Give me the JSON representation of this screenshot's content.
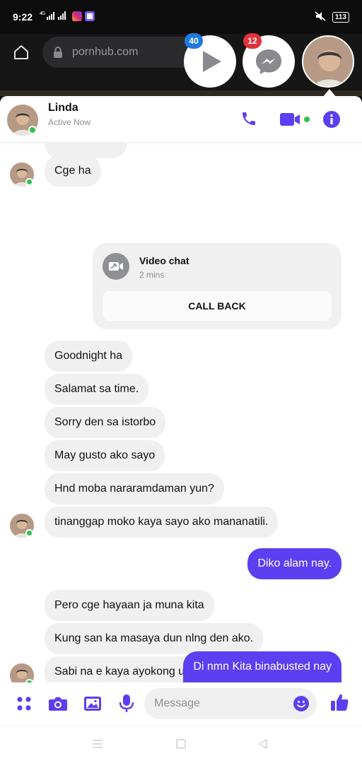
{
  "status_bar": {
    "time": "9:22",
    "signal": "4G",
    "battery": "113"
  },
  "browser": {
    "url": "pornhub.com"
  },
  "chat_heads": {
    "play_badge": "40",
    "messenger_badge": "12"
  },
  "header": {
    "contact_name": "Linda",
    "status": "Active Now"
  },
  "messages": {
    "in_1": "Cge ha",
    "video_call": {
      "title": "Video chat",
      "duration": "2 mins",
      "button": "CALL BACK"
    },
    "in_2": "Goodnight ha",
    "in_3": "Salamat sa time.",
    "in_4": "Sorry den sa istorbo",
    "in_5": "May gusto ako sayo",
    "in_6": "Hnd moba nararamdaman yun?",
    "in_7": "tinanggap moko kaya sayo ako mananatili.",
    "out_1": "Diko alam nay.",
    "in_8": "Pero cge hayaan ja muna kita",
    "in_9": "Kung san ka masaya dun nlng den ako.",
    "in_10": "Sabi na e kaya ayokong umamin",
    "out_2": "Di nmn Kita binabusted nay"
  },
  "composer": {
    "placeholder": "Message"
  },
  "colors": {
    "accent": "#5b3ff0",
    "online": "#31c24d",
    "incoming_bubble": "#f0f0f0"
  }
}
